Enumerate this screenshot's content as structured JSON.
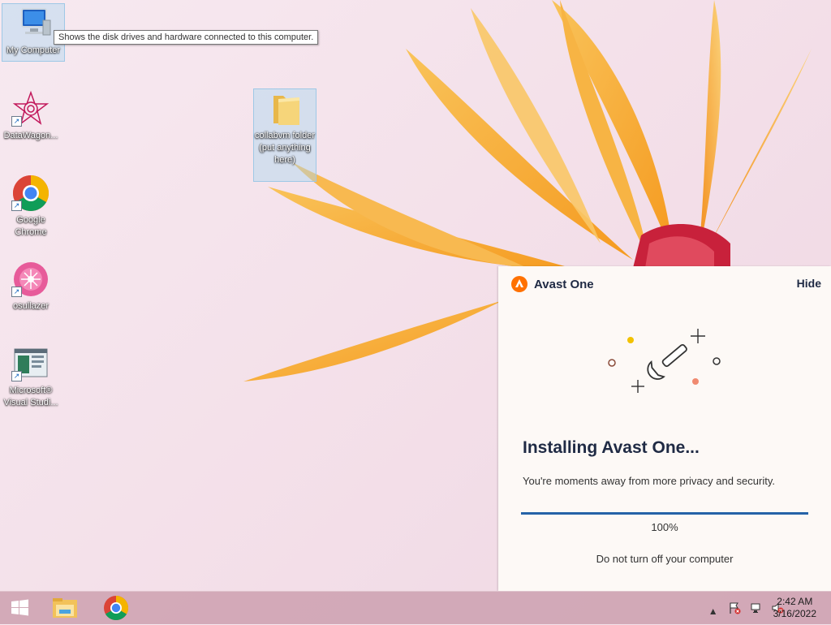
{
  "desktop": {
    "icons": [
      {
        "label": "My Computer"
      },
      {
        "label": "DataWagon..."
      },
      {
        "label": "Google Chrome"
      },
      {
        "label": "osullazer"
      },
      {
        "label": "Microsoft® Visual Studi..."
      },
      {
        "label": "collabvm folder (put anything here)"
      }
    ],
    "tooltip": "Shows the disk drives and hardware connected to this computer."
  },
  "avast": {
    "title": "Avast One",
    "hide_label": "Hide",
    "heading": "Installing Avast One...",
    "subtitle": "You're moments away from more privacy and security.",
    "progress_percent": 100,
    "progress_label": "100%",
    "note": "Do not turn off your computer",
    "accent_color": "#ff7100",
    "progress_color": "#2563a8"
  },
  "taskbar": {
    "pinned": [
      "windows-start-icon",
      "file-explorer-icon",
      "chrome-icon"
    ],
    "tray_icons": [
      "show-hidden-icons-arrow-icon",
      "action-center-flag-icon",
      "network-icon",
      "volume-muted-icon"
    ],
    "clock_time": "2:42 AM",
    "clock_date": "3/16/2022"
  }
}
